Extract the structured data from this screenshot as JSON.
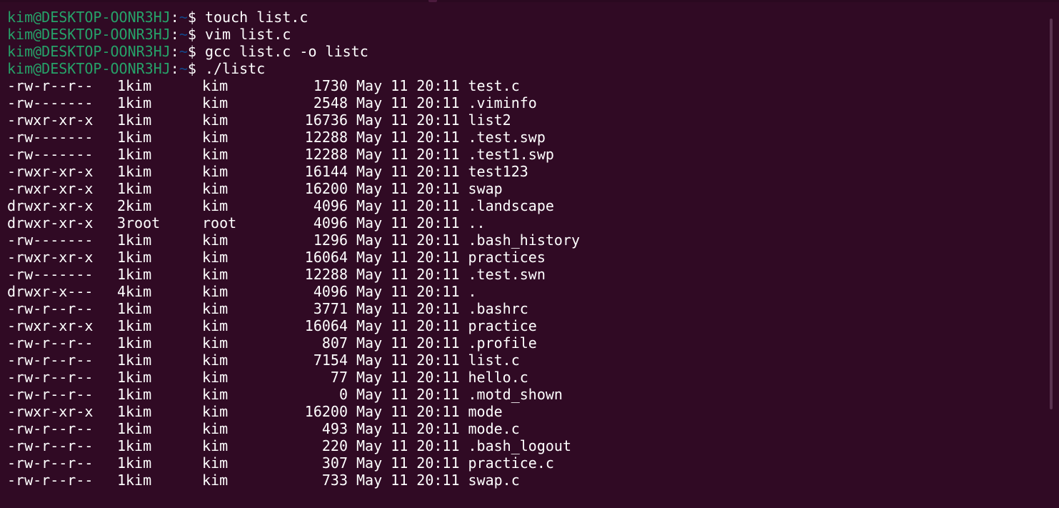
{
  "colors": {
    "background": "#300a24",
    "prompt_user": "#26a269",
    "prompt_path": "#12488b",
    "text": "#ffffff"
  },
  "prompt": {
    "user_host": "kim@DESKTOP-OONR3HJ",
    "colon": ":",
    "path": "~",
    "symbol": "$"
  },
  "commands": [
    "touch list.c",
    "vim list.c",
    "gcc list.c -o listc",
    "./listc"
  ],
  "listing": [
    {
      "perm": "-rw-r--r--",
      "links": "1",
      "owner": "kim",
      "group": "kim",
      "size": "1730",
      "date": "May 11 20:11",
      "name": "test.c"
    },
    {
      "perm": "-rw-------",
      "links": "1",
      "owner": "kim",
      "group": "kim",
      "size": "2548",
      "date": "May 11 20:11",
      "name": ".viminfo"
    },
    {
      "perm": "-rwxr-xr-x",
      "links": "1",
      "owner": "kim",
      "group": "kim",
      "size": "16736",
      "date": "May 11 20:11",
      "name": "list2"
    },
    {
      "perm": "-rw-------",
      "links": "1",
      "owner": "kim",
      "group": "kim",
      "size": "12288",
      "date": "May 11 20:11",
      "name": ".test.swp"
    },
    {
      "perm": "-rw-------",
      "links": "1",
      "owner": "kim",
      "group": "kim",
      "size": "12288",
      "date": "May 11 20:11",
      "name": ".test1.swp"
    },
    {
      "perm": "-rwxr-xr-x",
      "links": "1",
      "owner": "kim",
      "group": "kim",
      "size": "16144",
      "date": "May 11 20:11",
      "name": "test123"
    },
    {
      "perm": "-rwxr-xr-x",
      "links": "1",
      "owner": "kim",
      "group": "kim",
      "size": "16200",
      "date": "May 11 20:11",
      "name": "swap"
    },
    {
      "perm": "drwxr-xr-x",
      "links": "2",
      "owner": "kim",
      "group": "kim",
      "size": "4096",
      "date": "May 11 20:11",
      "name": ".landscape"
    },
    {
      "perm": "drwxr-xr-x",
      "links": "3",
      "owner": "root",
      "group": "root",
      "size": "4096",
      "date": "May 11 20:11",
      "name": ".."
    },
    {
      "perm": "-rw-------",
      "links": "1",
      "owner": "kim",
      "group": "kim",
      "size": "1296",
      "date": "May 11 20:11",
      "name": ".bash_history"
    },
    {
      "perm": "-rwxr-xr-x",
      "links": "1",
      "owner": "kim",
      "group": "kim",
      "size": "16064",
      "date": "May 11 20:11",
      "name": "practices"
    },
    {
      "perm": "-rw-------",
      "links": "1",
      "owner": "kim",
      "group": "kim",
      "size": "12288",
      "date": "May 11 20:11",
      "name": ".test.swn"
    },
    {
      "perm": "drwxr-x---",
      "links": "4",
      "owner": "kim",
      "group": "kim",
      "size": "4096",
      "date": "May 11 20:11",
      "name": "."
    },
    {
      "perm": "-rw-r--r--",
      "links": "1",
      "owner": "kim",
      "group": "kim",
      "size": "3771",
      "date": "May 11 20:11",
      "name": ".bashrc"
    },
    {
      "perm": "-rwxr-xr-x",
      "links": "1",
      "owner": "kim",
      "group": "kim",
      "size": "16064",
      "date": "May 11 20:11",
      "name": "practice"
    },
    {
      "perm": "-rw-r--r--",
      "links": "1",
      "owner": "kim",
      "group": "kim",
      "size": "807",
      "date": "May 11 20:11",
      "name": ".profile"
    },
    {
      "perm": "-rw-r--r--",
      "links": "1",
      "owner": "kim",
      "group": "kim",
      "size": "7154",
      "date": "May 11 20:11",
      "name": "list.c"
    },
    {
      "perm": "-rw-r--r--",
      "links": "1",
      "owner": "kim",
      "group": "kim",
      "size": "77",
      "date": "May 11 20:11",
      "name": "hello.c"
    },
    {
      "perm": "-rw-r--r--",
      "links": "1",
      "owner": "kim",
      "group": "kim",
      "size": "0",
      "date": "May 11 20:11",
      "name": ".motd_shown"
    },
    {
      "perm": "-rwxr-xr-x",
      "links": "1",
      "owner": "kim",
      "group": "kim",
      "size": "16200",
      "date": "May 11 20:11",
      "name": "mode"
    },
    {
      "perm": "-rw-r--r--",
      "links": "1",
      "owner": "kim",
      "group": "kim",
      "size": "493",
      "date": "May 11 20:11",
      "name": "mode.c"
    },
    {
      "perm": "-rw-r--r--",
      "links": "1",
      "owner": "kim",
      "group": "kim",
      "size": "220",
      "date": "May 11 20:11",
      "name": ".bash_logout"
    },
    {
      "perm": "-rw-r--r--",
      "links": "1",
      "owner": "kim",
      "group": "kim",
      "size": "307",
      "date": "May 11 20:11",
      "name": "practice.c"
    },
    {
      "perm": "-rw-r--r--",
      "links": "1",
      "owner": "kim",
      "group": "kim",
      "size": "733",
      "date": "May 11 20:11",
      "name": "swap.c"
    }
  ]
}
